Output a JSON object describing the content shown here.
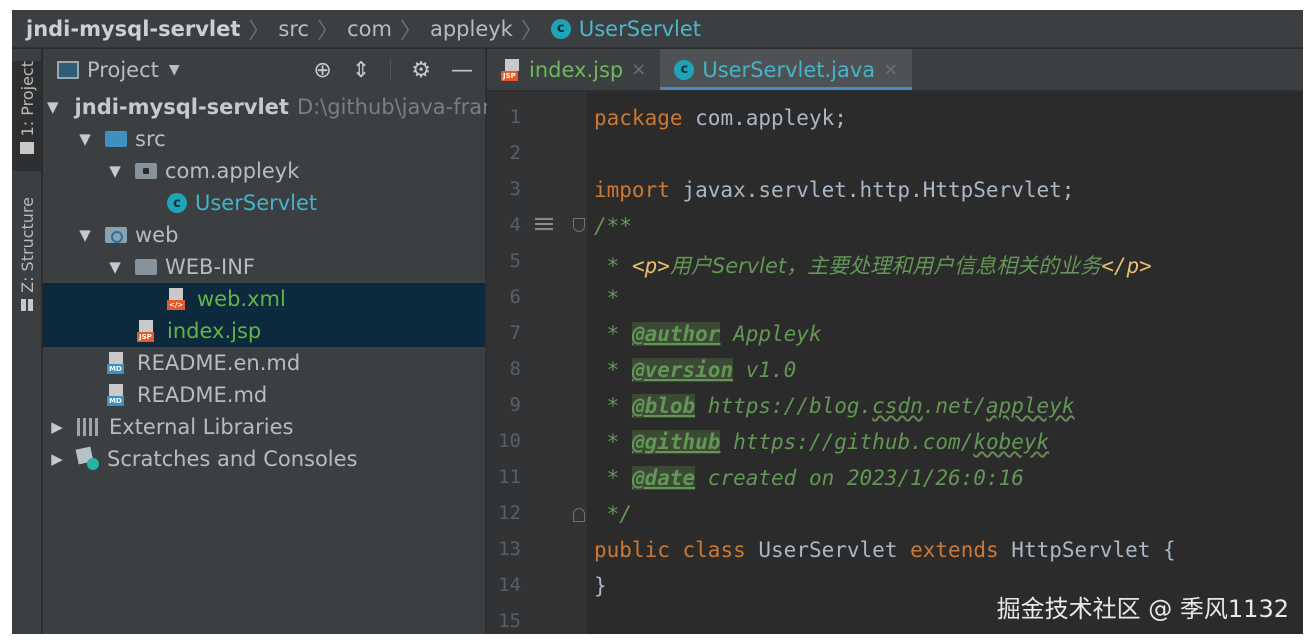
{
  "breadcrumb": {
    "items": [
      "jndi-mysql-servlet",
      "src",
      "com",
      "appleyk",
      "UserServlet"
    ]
  },
  "tool_stripe": {
    "project_tab": "1: Project",
    "structure_tab": "Z: Structure"
  },
  "project_panel": {
    "title": "Project",
    "tree": {
      "root": {
        "name": "jndi-mysql-servlet",
        "path": "D:\\github\\java-fran"
      },
      "src": "src",
      "package": "com.appleyk",
      "user_servlet": "UserServlet",
      "web": "web",
      "web_inf": "WEB-INF",
      "web_xml": "web.xml",
      "index_jsp": "index.jsp",
      "readme_en": "README.en.md",
      "readme": "README.md",
      "external_libraries": "External Libraries",
      "scratches": "Scratches and Consoles"
    }
  },
  "editor": {
    "tabs": [
      "index.jsp",
      "UserServlet.java"
    ],
    "line_numbers": [
      "1",
      "2",
      "3",
      "4",
      "5",
      "6",
      "7",
      "8",
      "9",
      "10",
      "11",
      "12",
      "13",
      "14",
      "15"
    ],
    "code": {
      "l1_kw": "package",
      "l1_rest": " com.appleyk;",
      "l3_kw": "import",
      "l3_rest": " javax.servlet.http.HttpServlet;",
      "l4": "/**",
      "l5_star": " * ",
      "l5_open": "<p>",
      "l5_text": "用户Servlet，主要处理和用户信息相关的业务",
      "l5_close": "</p>",
      "l6": " *",
      "l7_star": " * ",
      "l7_tag": "@author",
      "l7_val": " Appleyk",
      "l8_star": " * ",
      "l8_tag": "@version",
      "l8_val": " v1.0",
      "l9_star": " * ",
      "l9_tag": "@blob",
      "l9_val_a": " https://blog.",
      "l9_val_b": "csdn",
      "l9_val_c": ".net/",
      "l9_val_d": "appleyk",
      "l10_star": " * ",
      "l10_tag": "@github",
      "l10_val_a": " https://github.com/",
      "l10_val_b": "kobeyk",
      "l11_star": " * ",
      "l11_tag": "@date",
      "l11_val": " created on 2023/1/26:0:16",
      "l12": " */",
      "l13_kw1": "public",
      "l13_kw2": "class",
      "l13_name": "UserServlet",
      "l13_kw3": "extends",
      "l13_rest": "HttpServlet {",
      "l14": "}"
    }
  },
  "watermark": "掘金技术社区 @ 季风1132"
}
